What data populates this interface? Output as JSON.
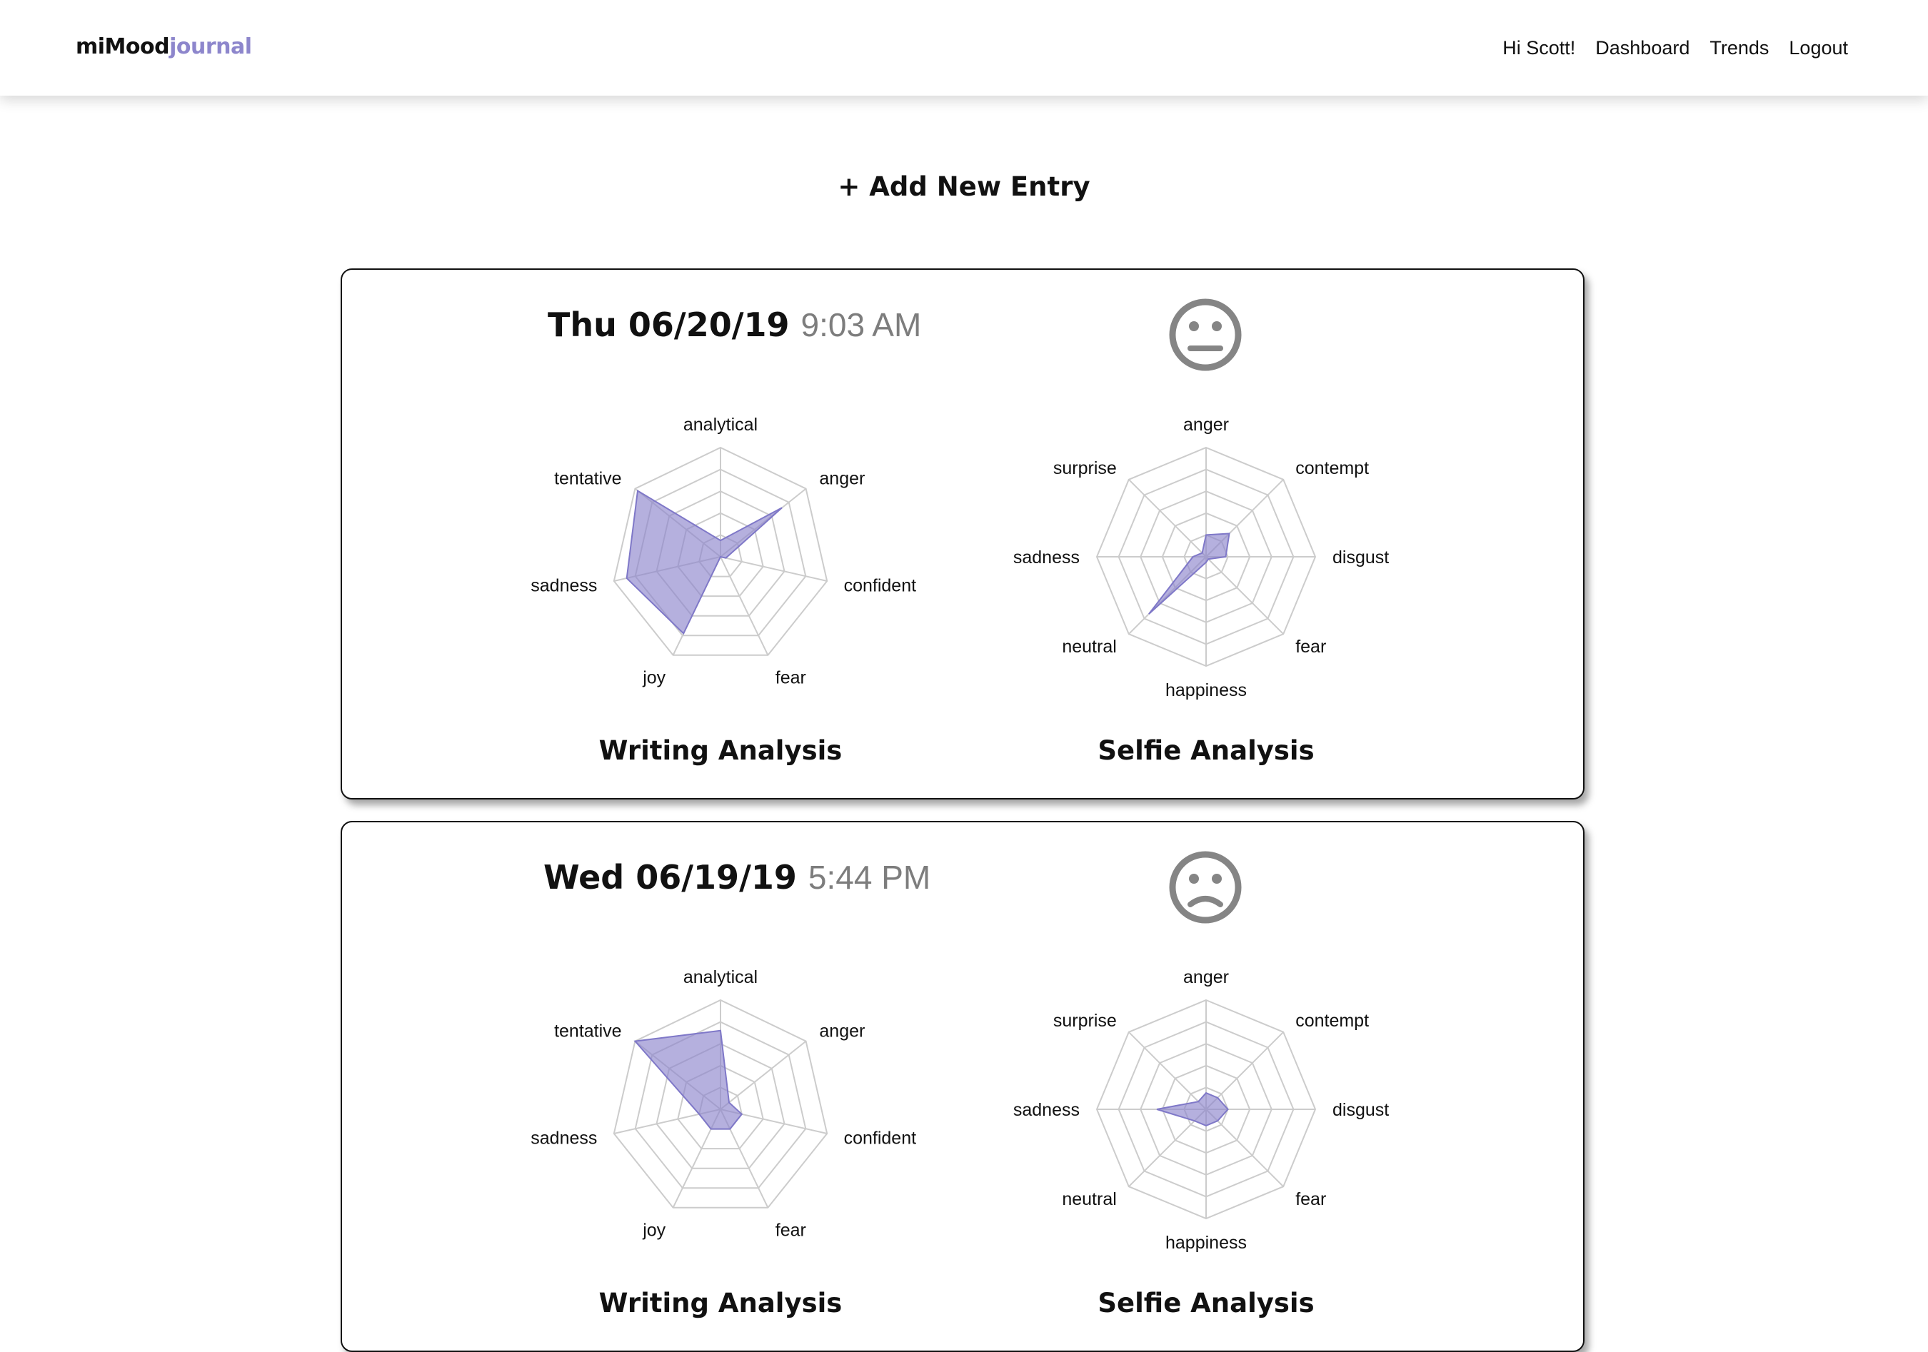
{
  "app": {
    "brand_part1": "miMood",
    "brand_part2": "journal",
    "accent_color": "#8d86cc"
  },
  "nav": {
    "items": [
      "Hi Scott!",
      "Dashboard",
      "Trends",
      "Logout"
    ]
  },
  "add_entry_label": "+ Add New Entry",
  "entries": [
    {
      "date": "Thu 06/20/19",
      "time": "9:03 AM",
      "mood_icon": "neutral-face-icon",
      "writing": {
        "title": "Writing Analysis",
        "axes": [
          "analytical",
          "anger",
          "confident",
          "fear",
          "joy",
          "sadness",
          "tentative"
        ],
        "values": [
          0.15,
          0.72,
          0.05,
          0.0,
          0.78,
          0.88,
          0.97
        ]
      },
      "selfie": {
        "title": "Selfie Analysis",
        "axes": [
          "anger",
          "contempt",
          "disgust",
          "fear",
          "happiness",
          "neutral",
          "sadness",
          "surprise"
        ],
        "values": [
          0.2,
          0.3,
          0.18,
          0.03,
          0.05,
          0.74,
          0.12,
          0.05
        ]
      }
    },
    {
      "date": "Wed 06/19/19",
      "time": "5:44 PM",
      "mood_icon": "sad-face-icon",
      "writing": {
        "title": "Writing Analysis",
        "axes": [
          "analytical",
          "anger",
          "confident",
          "fear",
          "joy",
          "sadness",
          "tentative"
        ],
        "values": [
          0.72,
          0.1,
          0.2,
          0.2,
          0.2,
          0.2,
          1.0
        ]
      },
      "selfie": {
        "title": "Selfie Analysis",
        "axes": [
          "anger",
          "contempt",
          "disgust",
          "fear",
          "happiness",
          "neutral",
          "sadness",
          "surprise"
        ],
        "values": [
          0.15,
          0.15,
          0.2,
          0.15,
          0.15,
          0.15,
          0.45,
          0.1
        ]
      }
    }
  ]
}
